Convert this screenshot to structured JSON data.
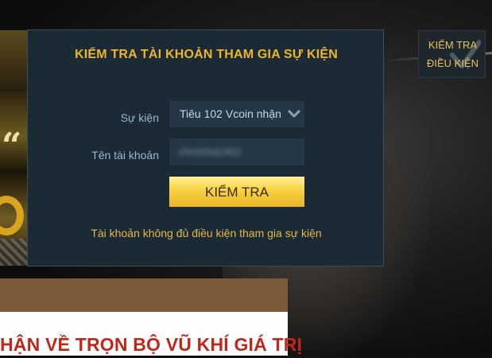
{
  "background": {
    "banner_text": "HẬN VỀ TRỌN BỘ VŨ KHÍ GIÁ TRỊ",
    "left_art_glyph": "“"
  },
  "event_check_button": {
    "line1": "KIỂM TRA",
    "line2": "ĐIỀU KIỆN",
    "icon": "checkmark-icon"
  },
  "modal": {
    "title": "KIỂM TRA TÀI KHOẢN THAM GIA SỰ KIỆN",
    "event_label": "Sự kiện",
    "event_selected": "Tiêu 102 Vcoin nhận",
    "account_label": "Tên tài khoản",
    "account_value": "zhminhq1402",
    "submit_label": "KIỂM TRA",
    "status_message": "Tài khoản không đủ điều kiện tham gia sự kiện"
  },
  "colors": {
    "accent_gold": "#eab52f",
    "modal_bg": "#1c2a36",
    "banner_red": "#c0261a"
  }
}
